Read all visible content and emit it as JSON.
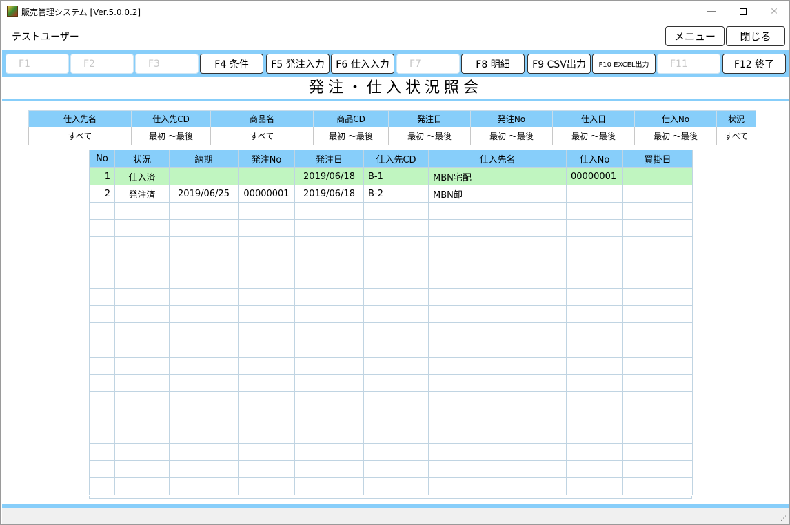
{
  "window": {
    "title": "販売管理システム [Ver.5.0.0.2]",
    "minimize_glyph": "—",
    "close_glyph": "✕"
  },
  "header": {
    "user": "テストユーザー",
    "menu_label": "メニュー",
    "close_label": "閉じる"
  },
  "fkeys": [
    {
      "label": "F1",
      "enabled": false
    },
    {
      "label": "F2",
      "enabled": false
    },
    {
      "label": "F3",
      "enabled": false
    },
    {
      "label": "F4 条件",
      "enabled": true
    },
    {
      "label": "F5 発注入力",
      "enabled": true
    },
    {
      "label": "F6 仕入入力",
      "enabled": true
    },
    {
      "label": "F7",
      "enabled": false
    },
    {
      "label": "F8 明細",
      "enabled": true
    },
    {
      "label": "F9 CSV出力",
      "enabled": true
    },
    {
      "label": "F10 EXCEL出力",
      "enabled": true
    },
    {
      "label": "F11",
      "enabled": false
    },
    {
      "label": "F12 終了",
      "enabled": true
    }
  ],
  "page_title": "発注・仕入状況照会",
  "filter": {
    "headers": [
      "仕入先名",
      "仕入先CD",
      "商品名",
      "商品CD",
      "発注日",
      "発注No",
      "仕入日",
      "仕入No",
      "状況"
    ],
    "values": [
      "すべて",
      "最初 ～最後",
      "すべて",
      "最初 ～最後",
      "最初 ～最後",
      "最初 ～最後",
      "最初 ～最後",
      "最初 ～最後",
      "すべて"
    ]
  },
  "grid": {
    "headers": [
      "No",
      "状況",
      "納期",
      "発注No",
      "発注日",
      "仕入先CD",
      "仕入先名",
      "仕入No",
      "買掛日"
    ],
    "rows": [
      [
        "1",
        "仕入済",
        "",
        "",
        "2019/06/18",
        "B-1",
        "MBN宅配",
        "00000001",
        ""
      ],
      [
        "2",
        "発注済",
        "2019/06/25",
        "00000001",
        "2019/06/18",
        "B-2",
        "MBN卸",
        "",
        ""
      ]
    ],
    "highlighted_row": 0,
    "empty_rows": 17
  },
  "colors": {
    "accent": "#87cefa",
    "highlight": "#c0f5c0"
  }
}
